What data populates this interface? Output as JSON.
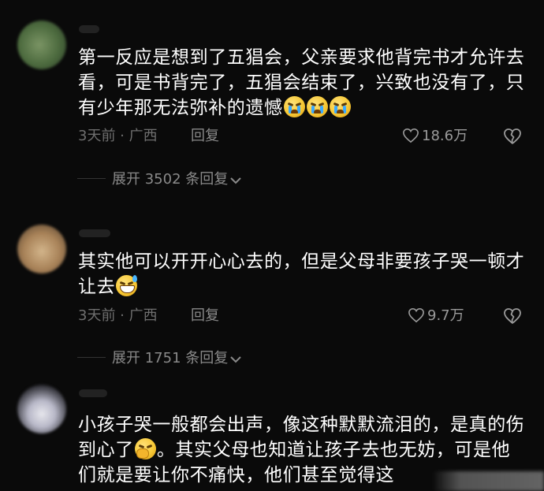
{
  "comments": [
    {
      "text_part1": "第一反应是想到了五猖会，父亲要求他背完书才允许去看，可是书背完了，五猖会结束了，兴致也没有了，只有少年那无法弥补的遗憾",
      "emojis": [
        "loudly-crying-face",
        "loudly-crying-face",
        "loudly-crying-face"
      ],
      "meta": "3天前 · 广西",
      "reply_label": "回复",
      "likes": "18.6万",
      "expand_label": "展开 3502 条回复"
    },
    {
      "text_part1": "其实他可以开开心心去的，但是父母非要孩子哭一顿才让去",
      "emojis": [
        "grinning-face-with-sweat"
      ],
      "meta": "3天前 · 广西",
      "reply_label": "回复",
      "likes": "9.7万",
      "expand_label": "展开 1751 条回复"
    },
    {
      "text_part1": "小孩子哭一般都会出声，像这种默默流泪的，是真的伤到心了",
      "emojis": [
        "face-with-hand-over-mouth"
      ],
      "text_part2": "。其实父母也知道让孩子去也无妨，可是他们就是要让你不痛快，他们甚至觉得这"
    }
  ],
  "colors": {
    "background": "#0a0a0a",
    "text": "#ffffff",
    "meta": "#6f6f6f",
    "accent_emoji": "#f7c936"
  }
}
